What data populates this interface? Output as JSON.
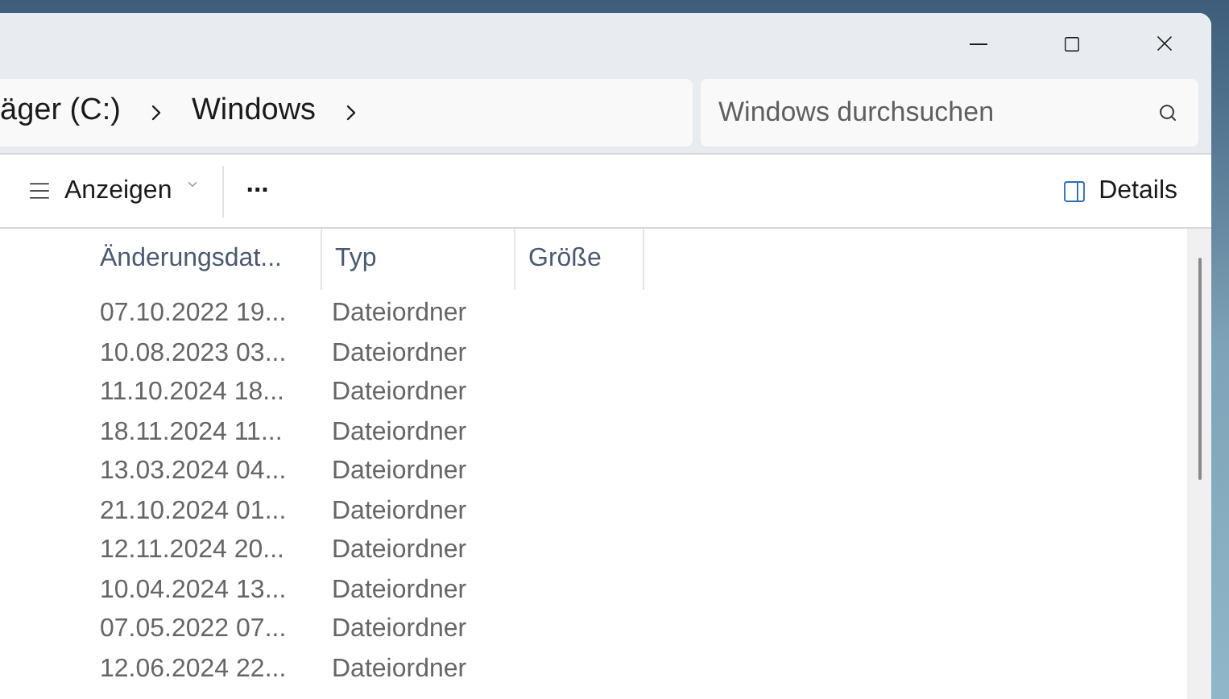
{
  "title_bar": {
    "buttons": [
      {
        "kind": "minimize"
      },
      {
        "kind": "maximize"
      },
      {
        "kind": "close"
      }
    ]
  },
  "address_bar": {
    "segments": [
      "äger (C:)",
      "Windows"
    ]
  },
  "search": {
    "placeholder": "Windows durchsuchen"
  },
  "toolbar": {
    "view_button": "Anzeigen",
    "more_button": "...",
    "details_button": "Details"
  },
  "table": {
    "columns": [
      "Änderungsdat...",
      "Typ",
      "Größe"
    ],
    "rows": [
      [
        "07.10.2022 19...",
        "Dateiordner"
      ],
      [
        "10.08.2023 03...",
        "Dateiordner"
      ],
      [
        "11.10.2024 18...",
        "Dateiordner"
      ],
      [
        "18.11.2024 11...",
        "Dateiordner"
      ],
      [
        "13.03.2024 04...",
        "Dateiordner"
      ],
      [
        "21.10.2024 01...",
        "Dateiordner"
      ],
      [
        "12.11.2024 20...",
        "Dateiordner"
      ],
      [
        "10.04.2024 13...",
        "Dateiordner"
      ],
      [
        "07.05.2022 07...",
        "Dateiordner"
      ],
      [
        "12.06.2024 22...",
        "Dateiordner"
      ]
    ]
  }
}
